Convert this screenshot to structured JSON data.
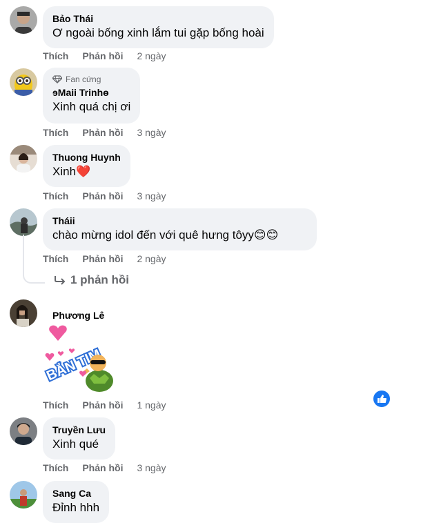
{
  "labels": {
    "like": "Thích",
    "reply": "Phản hồi"
  },
  "comments": [
    {
      "name": "Bảo Thái",
      "text": "Ơ ngoài bống xinh lắm tui gặp bống hoài",
      "time": "2 ngày"
    },
    {
      "badge": "Fan cứng",
      "name": "ɘMaii Trinhɵ",
      "text": "Xinh quá chị ơi",
      "time": "3 ngày"
    },
    {
      "name": "Thuong Huynh",
      "text": "Xinh",
      "emoji": "❤️",
      "time": "3 ngày"
    },
    {
      "name": "Tháii",
      "text": "chào mừng idol đến với quê hưng tôyy",
      "emoji": "😊😊",
      "time": "2 ngày"
    },
    {
      "name": "Phương Lê",
      "sticker_text": "BẮN TIM",
      "time": "1 ngày"
    },
    {
      "name": "Truyền Lưu",
      "text": "Xinh qué",
      "time": "3 ngày"
    },
    {
      "name": "Sang Ca",
      "text": "Đỉnh hhh"
    }
  ],
  "replies_link": "1 phản hồi",
  "colors": {
    "bubble": "#f0f2f5",
    "secondary": "#65676b",
    "accent": "#1877f2"
  }
}
